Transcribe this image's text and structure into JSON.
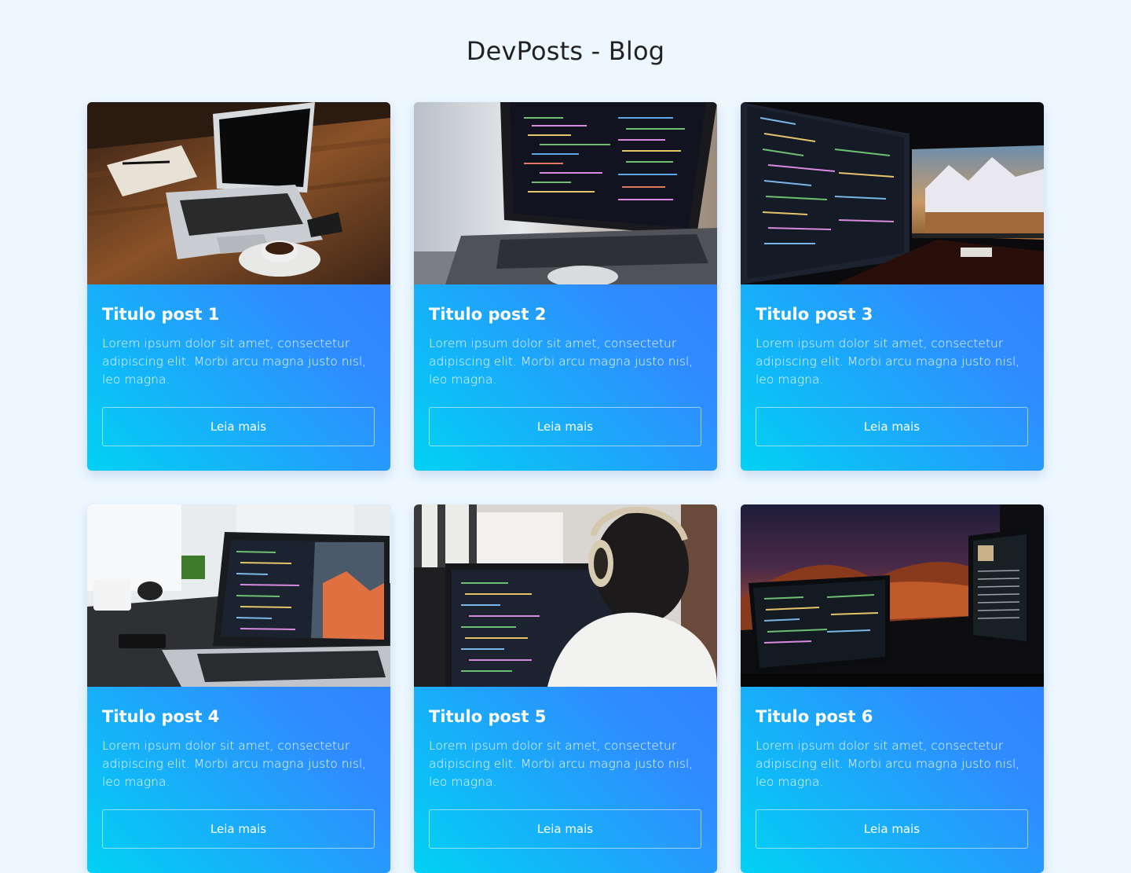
{
  "page": {
    "title": "DevPosts - Blog"
  },
  "posts": [
    {
      "title": "Titulo post 1",
      "text": "Lorem ipsum dolor sit amet, consectetur adipiscing elit. Morbi arcu magna justo nisl, leo magna.",
      "button": "Leia mais",
      "image": "laptop-on-wooden-desk-with-coffee"
    },
    {
      "title": "Titulo post 2",
      "text": "Lorem ipsum dolor sit amet, consectetur adipiscing elit. Morbi arcu magna justo nisl, leo magna.",
      "button": "Leia mais",
      "image": "laptop-with-code-editor"
    },
    {
      "title": "Titulo post 3",
      "text": "Lorem ipsum dolor sit amet, consectetur adipiscing elit. Morbi arcu magna justo nisl, leo magna.",
      "button": "Leia mais",
      "image": "dual-monitor-setup-with-code"
    },
    {
      "title": "Titulo post 4",
      "text": "Lorem ipsum dolor sit amet, consectetur adipiscing elit. Morbi arcu magna justo nisl, leo magna.",
      "button": "Leia mais",
      "image": "macbook-with-code-and-coffee-mug"
    },
    {
      "title": "Titulo post 5",
      "text": "Lorem ipsum dolor sit amet, consectetur adipiscing elit. Morbi arcu magna justo nisl, leo magna.",
      "button": "Leia mais",
      "image": "developer-with-headphones-at-monitor"
    },
    {
      "title": "Titulo post 6",
      "text": "Lorem ipsum dolor sit amet, consectetur adipiscing elit. Morbi arcu magna justo nisl, leo magna.",
      "button": "Leia mais",
      "image": "dark-desk-with-monitors-desert-wallpaper"
    }
  ],
  "colors": {
    "background": "#edf7ff",
    "card_gradient_start": "#00d2f3",
    "card_gradient_end": "#3478ff"
  }
}
